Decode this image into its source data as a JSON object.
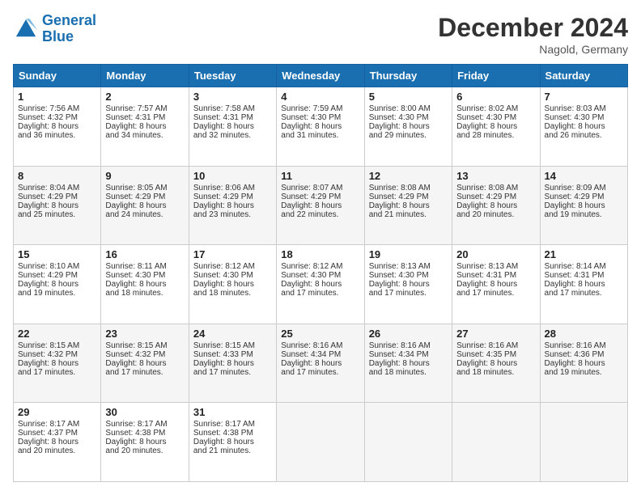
{
  "header": {
    "logo_line1": "General",
    "logo_line2": "Blue",
    "title": "December 2024",
    "location": "Nagold, Germany"
  },
  "weekdays": [
    "Sunday",
    "Monday",
    "Tuesday",
    "Wednesday",
    "Thursday",
    "Friday",
    "Saturday"
  ],
  "weeks": [
    [
      {
        "day": "1",
        "info": "Sunrise: 7:56 AM\nSunset: 4:32 PM\nDaylight: 8 hours\nand 36 minutes."
      },
      {
        "day": "2",
        "info": "Sunrise: 7:57 AM\nSunset: 4:31 PM\nDaylight: 8 hours\nand 34 minutes."
      },
      {
        "day": "3",
        "info": "Sunrise: 7:58 AM\nSunset: 4:31 PM\nDaylight: 8 hours\nand 32 minutes."
      },
      {
        "day": "4",
        "info": "Sunrise: 7:59 AM\nSunset: 4:30 PM\nDaylight: 8 hours\nand 31 minutes."
      },
      {
        "day": "5",
        "info": "Sunrise: 8:00 AM\nSunset: 4:30 PM\nDaylight: 8 hours\nand 29 minutes."
      },
      {
        "day": "6",
        "info": "Sunrise: 8:02 AM\nSunset: 4:30 PM\nDaylight: 8 hours\nand 28 minutes."
      },
      {
        "day": "7",
        "info": "Sunrise: 8:03 AM\nSunset: 4:30 PM\nDaylight: 8 hours\nand 26 minutes."
      }
    ],
    [
      {
        "day": "8",
        "info": "Sunrise: 8:04 AM\nSunset: 4:29 PM\nDaylight: 8 hours\nand 25 minutes."
      },
      {
        "day": "9",
        "info": "Sunrise: 8:05 AM\nSunset: 4:29 PM\nDaylight: 8 hours\nand 24 minutes."
      },
      {
        "day": "10",
        "info": "Sunrise: 8:06 AM\nSunset: 4:29 PM\nDaylight: 8 hours\nand 23 minutes."
      },
      {
        "day": "11",
        "info": "Sunrise: 8:07 AM\nSunset: 4:29 PM\nDaylight: 8 hours\nand 22 minutes."
      },
      {
        "day": "12",
        "info": "Sunrise: 8:08 AM\nSunset: 4:29 PM\nDaylight: 8 hours\nand 21 minutes."
      },
      {
        "day": "13",
        "info": "Sunrise: 8:08 AM\nSunset: 4:29 PM\nDaylight: 8 hours\nand 20 minutes."
      },
      {
        "day": "14",
        "info": "Sunrise: 8:09 AM\nSunset: 4:29 PM\nDaylight: 8 hours\nand 19 minutes."
      }
    ],
    [
      {
        "day": "15",
        "info": "Sunrise: 8:10 AM\nSunset: 4:29 PM\nDaylight: 8 hours\nand 19 minutes."
      },
      {
        "day": "16",
        "info": "Sunrise: 8:11 AM\nSunset: 4:30 PM\nDaylight: 8 hours\nand 18 minutes."
      },
      {
        "day": "17",
        "info": "Sunrise: 8:12 AM\nSunset: 4:30 PM\nDaylight: 8 hours\nand 18 minutes."
      },
      {
        "day": "18",
        "info": "Sunrise: 8:12 AM\nSunset: 4:30 PM\nDaylight: 8 hours\nand 17 minutes."
      },
      {
        "day": "19",
        "info": "Sunrise: 8:13 AM\nSunset: 4:30 PM\nDaylight: 8 hours\nand 17 minutes."
      },
      {
        "day": "20",
        "info": "Sunrise: 8:13 AM\nSunset: 4:31 PM\nDaylight: 8 hours\nand 17 minutes."
      },
      {
        "day": "21",
        "info": "Sunrise: 8:14 AM\nSunset: 4:31 PM\nDaylight: 8 hours\nand 17 minutes."
      }
    ],
    [
      {
        "day": "22",
        "info": "Sunrise: 8:15 AM\nSunset: 4:32 PM\nDaylight: 8 hours\nand 17 minutes."
      },
      {
        "day": "23",
        "info": "Sunrise: 8:15 AM\nSunset: 4:32 PM\nDaylight: 8 hours\nand 17 minutes."
      },
      {
        "day": "24",
        "info": "Sunrise: 8:15 AM\nSunset: 4:33 PM\nDaylight: 8 hours\nand 17 minutes."
      },
      {
        "day": "25",
        "info": "Sunrise: 8:16 AM\nSunset: 4:34 PM\nDaylight: 8 hours\nand 17 minutes."
      },
      {
        "day": "26",
        "info": "Sunrise: 8:16 AM\nSunset: 4:34 PM\nDaylight: 8 hours\nand 18 minutes."
      },
      {
        "day": "27",
        "info": "Sunrise: 8:16 AM\nSunset: 4:35 PM\nDaylight: 8 hours\nand 18 minutes."
      },
      {
        "day": "28",
        "info": "Sunrise: 8:16 AM\nSunset: 4:36 PM\nDaylight: 8 hours\nand 19 minutes."
      }
    ],
    [
      {
        "day": "29",
        "info": "Sunrise: 8:17 AM\nSunset: 4:37 PM\nDaylight: 8 hours\nand 20 minutes."
      },
      {
        "day": "30",
        "info": "Sunrise: 8:17 AM\nSunset: 4:38 PM\nDaylight: 8 hours\nand 20 minutes."
      },
      {
        "day": "31",
        "info": "Sunrise: 8:17 AM\nSunset: 4:38 PM\nDaylight: 8 hours\nand 21 minutes."
      },
      {
        "day": "",
        "info": ""
      },
      {
        "day": "",
        "info": ""
      },
      {
        "day": "",
        "info": ""
      },
      {
        "day": "",
        "info": ""
      }
    ]
  ]
}
